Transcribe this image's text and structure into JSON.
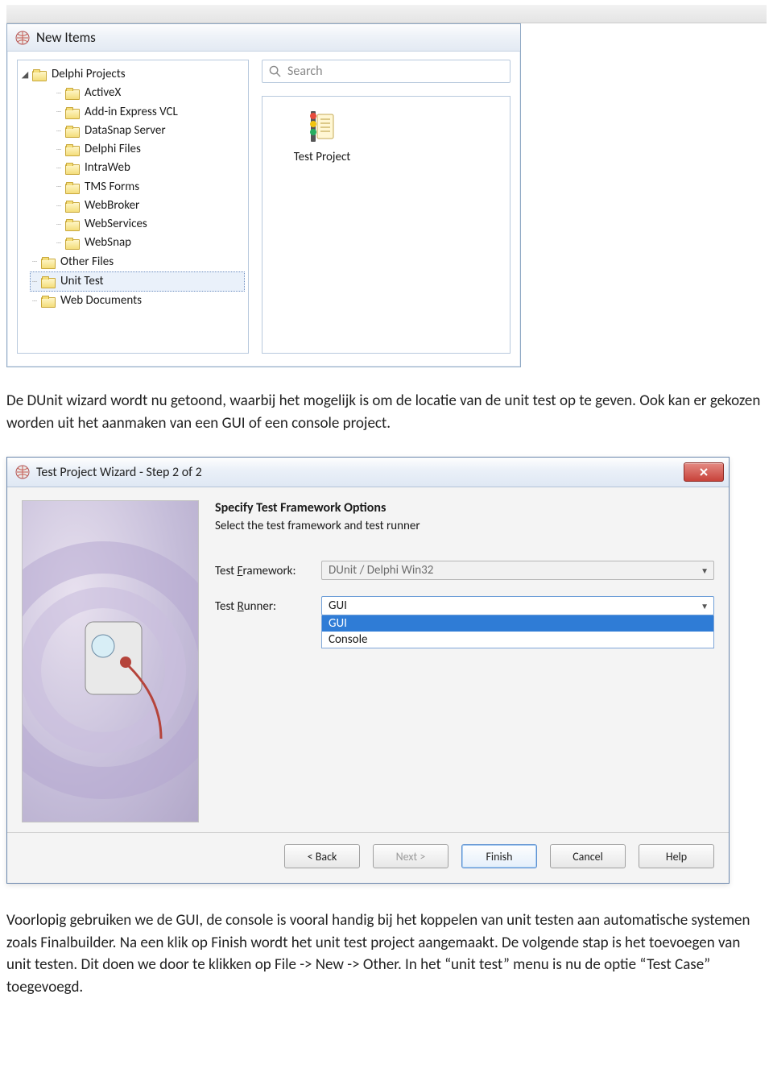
{
  "new_items": {
    "title": "New Items",
    "tree": {
      "root": "Delphi Projects",
      "children": [
        "ActiveX",
        "Add-in Express VCL",
        "DataSnap Server",
        "Delphi Files",
        "IntraWeb",
        "TMS Forms",
        "WebBroker",
        "WebServices",
        "WebSnap"
      ],
      "siblings": [
        "Other Files",
        "Unit Test",
        "Web Documents"
      ],
      "selected": "Unit Test"
    },
    "search_placeholder": "Search",
    "item_label": "Test Project"
  },
  "paragraph1": "De DUnit wizard wordt nu getoond, waarbij het mogelijk is om de locatie van de unit test op te geven. Ook kan er gekozen worden uit het aanmaken van een GUI of een console project.",
  "wizard": {
    "title": "Test Project Wizard - Step 2 of 2",
    "heading": "Specify Test Framework Options",
    "subheading": "Select the test framework and test runner",
    "framework_label_pre": "Test ",
    "framework_label_u": "F",
    "framework_label_post": "ramework:",
    "framework_value": "DUnit / Delphi Win32",
    "runner_label_pre": "Test ",
    "runner_label_u": "R",
    "runner_label_post": "unner:",
    "runner_value": "GUI",
    "runner_options": [
      "GUI",
      "Console"
    ],
    "buttons": {
      "back": "< Back",
      "next": "Next >",
      "finish": "Finish",
      "cancel": "Cancel",
      "help": "Help"
    }
  },
  "paragraph2": "Voorlopig gebruiken we de GUI, de console is vooral handig bij het koppelen van unit testen aan automatische systemen zoals Finalbuilder. Na een klik op Finish wordt het unit test project aangemaakt. De volgende stap is het toevoegen van unit testen. Dit doen we door te klikken op File -> New -> Other. In het “unit test” menu is nu de optie “Test Case” toegevoegd."
}
